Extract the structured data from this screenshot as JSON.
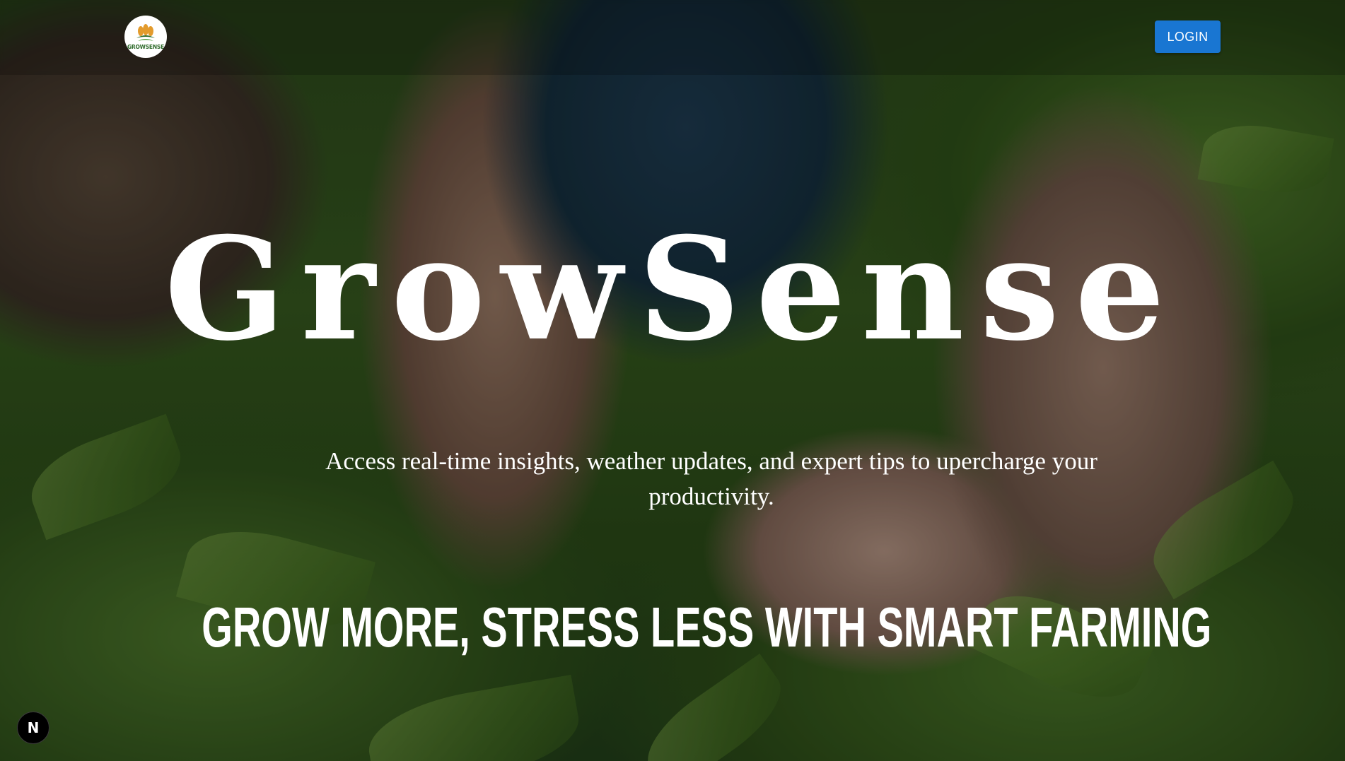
{
  "header": {
    "logo_text": "GROWSENSE",
    "login_label": "LOGIN"
  },
  "hero": {
    "title": "GrowSense",
    "subtitle": "Access real-time insights, weather updates, and expert tips to upercharge your productivity.",
    "tagline": "GROW MORE, STRESS LESS WITH SMART FARMING"
  },
  "dev_badge": {
    "label": "N"
  },
  "colors": {
    "login_button": "#1976d2",
    "text": "#ffffff",
    "logo_green": "#2e6b2a",
    "logo_orange": "#e39b2d"
  }
}
